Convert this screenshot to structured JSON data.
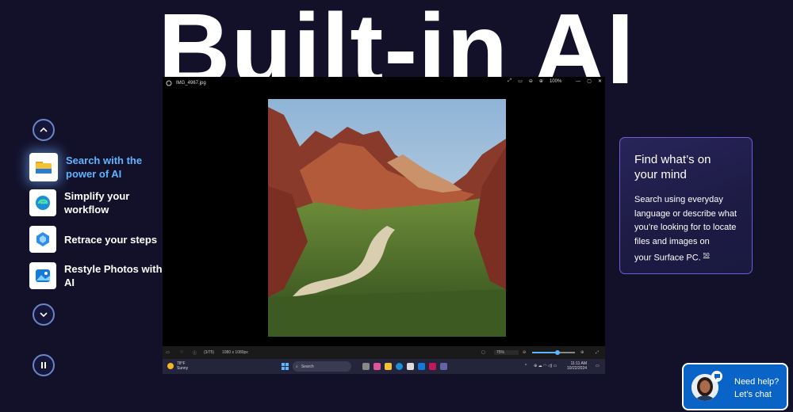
{
  "hero": {
    "title": "Built-in AI"
  },
  "nav": {
    "features": [
      {
        "label": "Search with the power of AI",
        "line1": "Search with the",
        "line2": "power of AI",
        "icon": "file-explorer-icon",
        "active": true
      },
      {
        "label": "Simplify your workflow",
        "line1": "Simplify your",
        "line2": "workflow",
        "icon": "edge-icon",
        "active": false
      },
      {
        "label": "Retrace your steps",
        "line1": "Retrace your steps",
        "line2": "",
        "icon": "recall-icon",
        "active": false
      },
      {
        "label": "Restyle Photos with AI",
        "line1": "Restyle Photos with",
        "line2": "AI",
        "icon": "photos-icon",
        "active": false
      }
    ]
  },
  "window": {
    "filename": "IMG_4967.jpg",
    "zoom_top": "100%",
    "counter": "(3/75)",
    "dimensions": "1080 x 1080px",
    "zoom_bottom": "75%"
  },
  "taskbar": {
    "weather_temp": "78°F",
    "weather_cond": "Sunny",
    "search_placeholder": "Search",
    "time": "11:11 AM",
    "date": "10/22/2024"
  },
  "info_card": {
    "title": "Find what’s on your mind",
    "title_line1": "Find what’s on",
    "title_line2": "your mind",
    "body_line1": "Search using everyday",
    "body_line2": "language or describe what",
    "body_line3": "you’re looking for to locate",
    "body_line4": "files and images on",
    "body_line5": "your Surface PC.",
    "footnote": "50"
  },
  "chat": {
    "line1": "Need help?",
    "line2": "Let’s chat"
  },
  "colors": {
    "background": "#13112a",
    "accent": "#5fb4ff",
    "card_border": "#6c5fd8",
    "chat_bg": "#0a64c8"
  }
}
